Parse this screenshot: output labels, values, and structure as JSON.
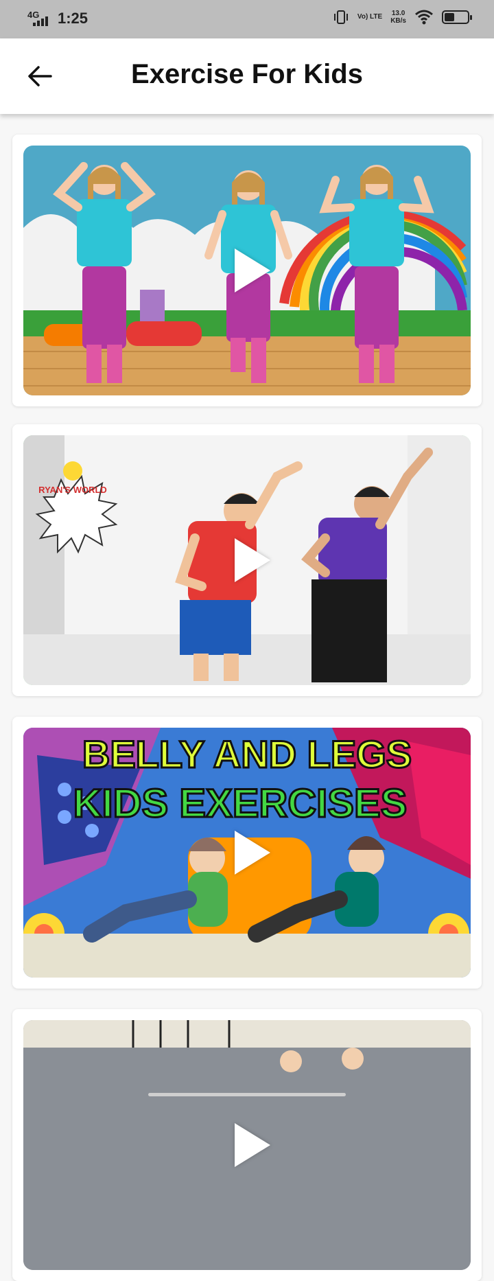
{
  "status_bar": {
    "network": "4G",
    "time": "1:25",
    "lte_label": "Vo) LTE",
    "speed_value": "13.0",
    "speed_unit": "KB/s",
    "battery_level": 0.45
  },
  "app_bar": {
    "title": "Exercise For Kids",
    "back_icon": "arrow-left-icon"
  },
  "videos": [
    {
      "id": 1,
      "thumbnail_text": "",
      "play_icon": "play-icon"
    },
    {
      "id": 2,
      "thumbnail_text": "RYAN'S WORLD",
      "play_icon": "play-icon"
    },
    {
      "id": 3,
      "thumbnail_line1": "BELLY AND LEGS",
      "thumbnail_line2": "KIDS EXERCISES",
      "play_icon": "play-icon"
    },
    {
      "id": 4,
      "thumbnail_text": "",
      "play_icon": "play-icon"
    }
  ],
  "colors": {
    "app_bar_bg": "#ffffff",
    "status_bar_bg": "#bdbdbd",
    "page_bg": "#f7f7f7",
    "card_bg": "#ffffff",
    "thumb2_border": "#2ecc40"
  }
}
